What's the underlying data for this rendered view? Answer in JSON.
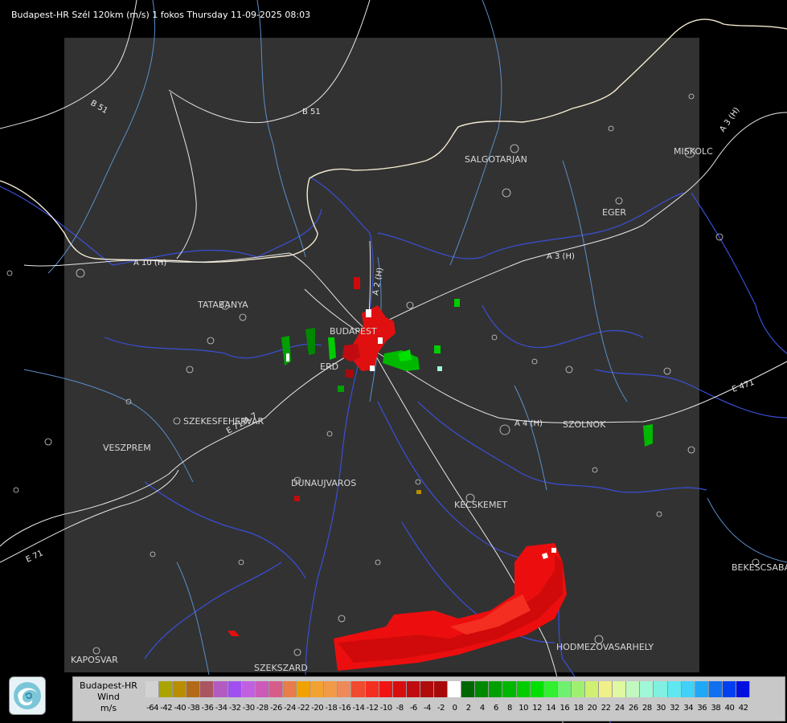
{
  "title": "Budapest-HR Szél 120km (m/s) 1 fokos Thursday 11-09-2025 08:03",
  "cities": [
    "SALGOTARJAN",
    "MISKOLC",
    "EGER",
    "TATABANYA",
    "BUDAPEST",
    "ERD",
    "SZEKESFEHERVAR",
    "VESZPREM",
    "DUNAUJVAROS",
    "KECSKEMET",
    "SZOLNOK",
    "BEKESCSABA",
    "HODMEZOVASARHELY",
    "KAPOSVAR",
    "SZEKSZARD"
  ],
  "roads": [
    "B 51",
    "B 51",
    "A 3 (H)",
    "A 3 (H)",
    "A 10 (H)",
    "A 2 (H)",
    "A 4 (H)",
    "E 471",
    "E 71/A 7",
    "E 71"
  ],
  "legend": {
    "station": "Budapest-HR",
    "quantity": "Wind",
    "unit": "m/s",
    "labels": [
      "-64",
      "-42",
      "-40",
      "-38",
      "-36",
      "-34",
      "-32",
      "-30",
      "-28",
      "-26",
      "-24",
      "-22",
      "-20",
      "-18",
      "-16",
      "-14",
      "-12",
      "-10",
      "-8",
      "-6",
      "-4",
      "-2",
      "0",
      "2",
      "4",
      "6",
      "8",
      "10",
      "12",
      "14",
      "16",
      "18",
      "20",
      "22",
      "24",
      "26",
      "28",
      "30",
      "32",
      "34",
      "36",
      "38",
      "40",
      "42"
    ],
    "colors": [
      "#d2d2d2",
      "#a9a400",
      "#b88e00",
      "#b36a18",
      "#aa5560",
      "#b25cc2",
      "#a050f0",
      "#c060e0",
      "#cc5ab8",
      "#d65c8a",
      "#e87c4a",
      "#f2a200",
      "#f2a230",
      "#f29a48",
      "#ee8a5a",
      "#f04a30",
      "#f42e20",
      "#f01414",
      "#d80e0e",
      "#c00c10",
      "#b00c0c",
      "#a80a0a",
      "#ffffff",
      "#006600",
      "#008800",
      "#00a000",
      "#00b800",
      "#00cc00",
      "#00e000",
      "#30f030",
      "#70f070",
      "#a0f070",
      "#d0f070",
      "#f0f088",
      "#e0f8a0",
      "#c0f8c0",
      "#a0f8d8",
      "#80f0e0",
      "#60e8f0",
      "#40d0f8",
      "#20a8f8",
      "#1070f0",
      "#0040f0",
      "#0010e0"
    ]
  }
}
